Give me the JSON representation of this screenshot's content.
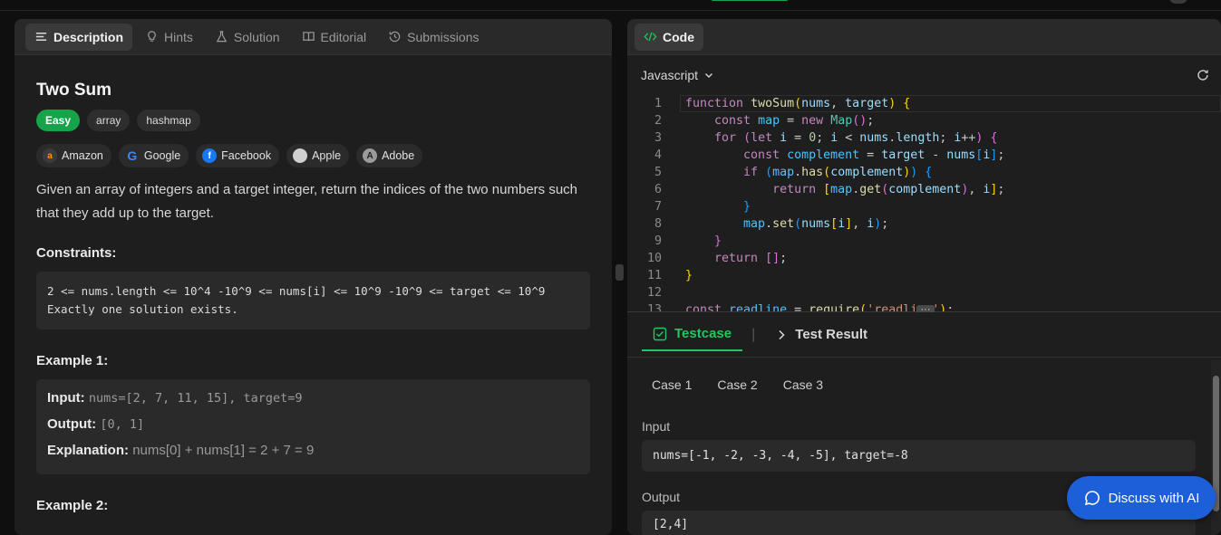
{
  "left_tabs": [
    {
      "label": "Description",
      "icon": "list-icon"
    },
    {
      "label": "Hints",
      "icon": "bulb-icon"
    },
    {
      "label": "Solution",
      "icon": "flask-icon"
    },
    {
      "label": "Editorial",
      "icon": "book-icon"
    },
    {
      "label": "Submissions",
      "icon": "history-icon"
    }
  ],
  "problem": {
    "title": "Two Sum",
    "difficulty": "Easy",
    "tags": [
      "array",
      "hashmap"
    ],
    "companies": [
      "Amazon",
      "Google",
      "Facebook",
      "Apple",
      "Adobe"
    ],
    "description": "Given an array of integers and a target integer, return the indices of the two numbers such that they add up to the target.",
    "constraints_heading": "Constraints:",
    "constraints": [
      "2 <= nums.length <= 10^4 -10^9 <= nums[i] <= 10^9 -10^9 <= target <= 10^9",
      "Exactly one solution exists."
    ],
    "example1_heading": "Example 1:",
    "example1": {
      "input_label": "Input:",
      "input": "nums=[2, 7, 11, 15], target=9",
      "output_label": "Output:",
      "output": "[0, 1]",
      "explanation_label": "Explanation:",
      "explanation": "nums[0] + nums[1] = 2 + 7 = 9"
    },
    "example2_heading": "Example 2:"
  },
  "code_panel": {
    "tab_label": "Code",
    "language": "Javascript",
    "line_numbers": [
      "1",
      "2",
      "3",
      "4",
      "5",
      "6",
      "7",
      "8",
      "9",
      "10",
      "11",
      "12",
      "13"
    ]
  },
  "bottom_panel": {
    "tab_testcase": "Testcase",
    "tab_result": "Test Result",
    "cases": [
      "Case 1",
      "Case 2",
      "Case 3"
    ],
    "input_label": "Input",
    "input_value": "nums=[-1, -2, -3, -4, -5], target=-8",
    "output_label": "Output",
    "output_value": "[2,4]"
  },
  "ai_button": "Discuss with AI",
  "colors": {
    "accent": "#16a34a",
    "ai": "#1d5fd8"
  }
}
